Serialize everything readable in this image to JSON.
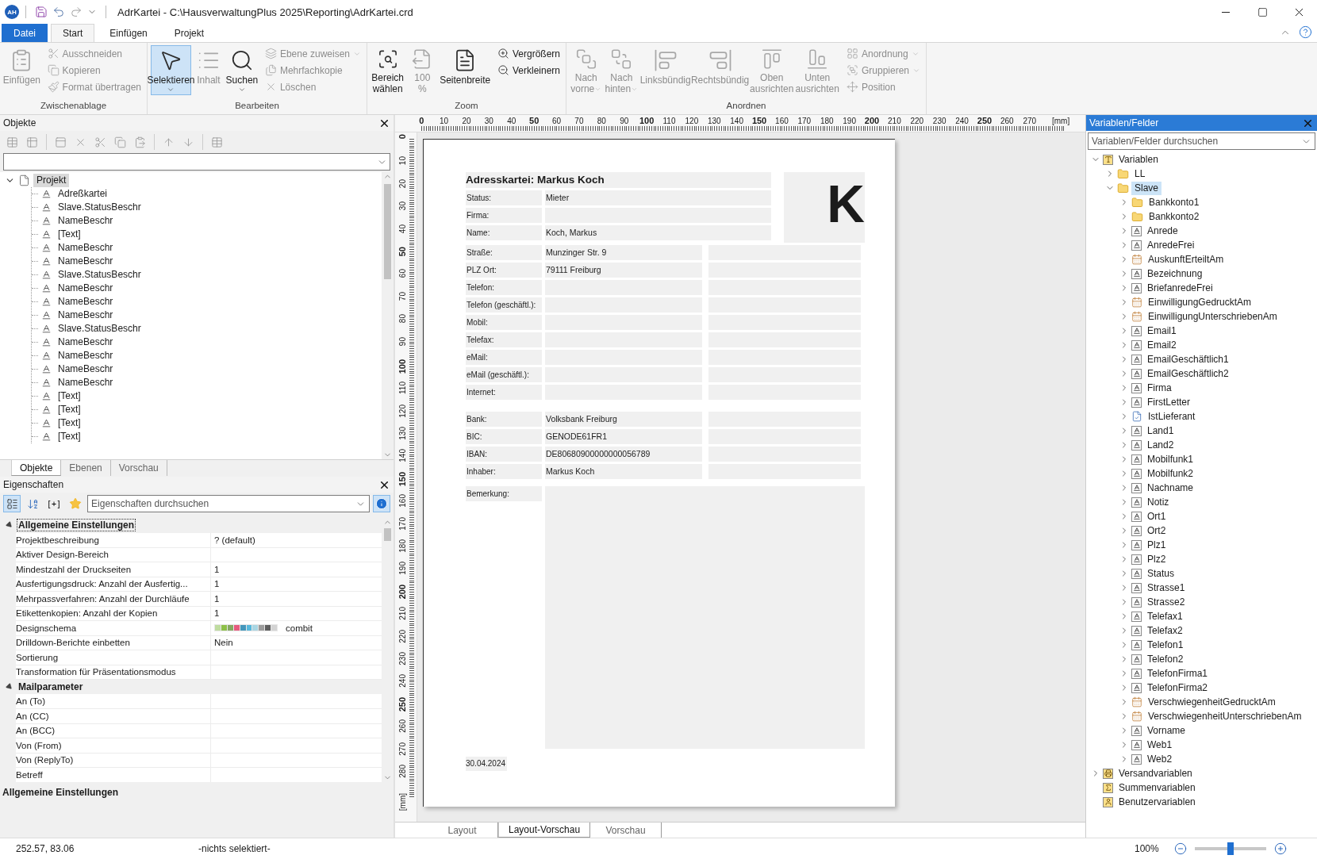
{
  "title_bar": {
    "app_badge": "AH",
    "title": "AdrKartei - C:\\HausverwaltungPlus 2025\\Reporting\\AdrKartei.crd"
  },
  "ribbon": {
    "tabs": [
      {
        "label": "Datei",
        "kind": "file",
        "selected": false
      },
      {
        "label": "Start",
        "kind": "tab",
        "selected": true
      },
      {
        "label": "Einfügen",
        "kind": "tab",
        "selected": false
      },
      {
        "label": "Projekt",
        "kind": "tab",
        "selected": false
      }
    ],
    "groups": [
      {
        "label": "Zwischenablage",
        "items": [
          {
            "kind": "large",
            "lines": [
              "Einfügen"
            ],
            "disabled": true,
            "selected": false,
            "dropdown": false
          },
          {
            "kind": "small",
            "lines": [
              "Ausschneiden"
            ],
            "disabled": true,
            "dropdown": false
          },
          {
            "kind": "small",
            "lines": [
              "Kopieren"
            ],
            "disabled": true,
            "dropdown": false
          },
          {
            "kind": "small",
            "lines": [
              "Format übertragen"
            ],
            "disabled": true,
            "dropdown": false
          }
        ]
      },
      {
        "label": "Bearbeiten",
        "items": [
          {
            "kind": "large",
            "lines": [
              "Selektieren"
            ],
            "disabled": false,
            "selected": true,
            "dropdown": true
          },
          {
            "kind": "large",
            "lines": [
              "Inhalt"
            ],
            "disabled": true,
            "selected": false,
            "dropdown": false
          },
          {
            "kind": "large",
            "lines": [
              "Suchen"
            ],
            "disabled": false,
            "selected": false,
            "dropdown": true
          },
          {
            "kind": "small",
            "lines": [
              "Ebene zuweisen"
            ],
            "disabled": true,
            "dropdown": true
          },
          {
            "kind": "small",
            "lines": [
              "Mehrfachkopie"
            ],
            "disabled": true,
            "dropdown": false
          },
          {
            "kind": "small",
            "lines": [
              "Löschen"
            ],
            "disabled": true,
            "dropdown": false
          }
        ]
      },
      {
        "label": "Zoom",
        "items": [
          {
            "kind": "large",
            "lines": [
              "Bereich",
              "wählen"
            ],
            "disabled": false,
            "selected": false,
            "dropdown": false
          },
          {
            "kind": "large",
            "lines": [
              "100",
              "%"
            ],
            "disabled": true,
            "selected": false,
            "dropdown": false
          },
          {
            "kind": "large",
            "lines": [
              "Seitenbreite"
            ],
            "disabled": false,
            "selected": false,
            "dropdown": false
          },
          {
            "kind": "small",
            "lines": [
              "Vergrößern"
            ],
            "disabled": false,
            "dropdown": false
          },
          {
            "kind": "small",
            "lines": [
              "Verkleinern"
            ],
            "disabled": false,
            "dropdown": false
          }
        ]
      },
      {
        "label": "Anordnen",
        "items": [
          {
            "kind": "large",
            "lines": [
              "Nach",
              "vorne"
            ],
            "disabled": true,
            "selected": false,
            "dropdown": true
          },
          {
            "kind": "large",
            "lines": [
              "Nach",
              "hinten"
            ],
            "disabled": true,
            "selected": false,
            "dropdown": true
          },
          {
            "kind": "large",
            "lines": [
              "Linksbündig"
            ],
            "disabled": true,
            "selected": false,
            "dropdown": false
          },
          {
            "kind": "large",
            "lines": [
              "Rechtsbündig"
            ],
            "disabled": true,
            "selected": false,
            "dropdown": false
          },
          {
            "kind": "large",
            "lines": [
              "Oben",
              "ausrichten"
            ],
            "disabled": true,
            "selected": false,
            "dropdown": false
          },
          {
            "kind": "large",
            "lines": [
              "Unten",
              "ausrichten"
            ],
            "disabled": true,
            "selected": false,
            "dropdown": false
          },
          {
            "kind": "small",
            "lines": [
              "Anordnung"
            ],
            "disabled": true,
            "dropdown": true
          },
          {
            "kind": "small",
            "lines": [
              "Gruppieren"
            ],
            "disabled": true,
            "dropdown": true
          },
          {
            "kind": "small",
            "lines": [
              "Position"
            ],
            "disabled": true,
            "dropdown": false
          }
        ]
      }
    ]
  },
  "objects_panel": {
    "title": "Objekte",
    "tree": {
      "label": "Projekt",
      "selected": true,
      "expanded": true,
      "children": [
        {
          "label": "Adreßkartei",
          "selected": false
        },
        {
          "label": "Slave.StatusBeschr",
          "selected": false
        },
        {
          "label": "NameBeschr",
          "selected": false
        },
        {
          "label": "[Text]",
          "selected": false
        },
        {
          "label": "NameBeschr",
          "selected": false
        },
        {
          "label": "NameBeschr",
          "selected": false
        },
        {
          "label": "Slave.StatusBeschr",
          "selected": false
        },
        {
          "label": "NameBeschr",
          "selected": false
        },
        {
          "label": "NameBeschr",
          "selected": false
        },
        {
          "label": "NameBeschr",
          "selected": false
        },
        {
          "label": "Slave.StatusBeschr",
          "selected": false
        },
        {
          "label": "NameBeschr",
          "selected": false
        },
        {
          "label": "NameBeschr",
          "selected": false
        },
        {
          "label": "NameBeschr",
          "selected": false
        },
        {
          "label": "NameBeschr",
          "selected": false
        },
        {
          "label": "[Text]",
          "selected": false
        },
        {
          "label": "[Text]",
          "selected": false
        },
        {
          "label": "[Text]",
          "selected": false
        },
        {
          "label": "[Text]",
          "selected": false
        }
      ]
    },
    "tabs": [
      {
        "label": "Objekte",
        "selected": true
      },
      {
        "label": "Ebenen",
        "selected": false
      },
      {
        "label": "Vorschau",
        "selected": false
      }
    ]
  },
  "properties_panel": {
    "title": "Eigenschaften",
    "toolbar": [
      {
        "kind": "categorized",
        "selected": true
      },
      {
        "kind": "sort",
        "selected": false
      },
      {
        "kind": "expand",
        "glyph": "[+]",
        "selected": false
      },
      {
        "kind": "favorites",
        "selected": false
      }
    ],
    "search": {
      "placeholder": "Eigenschaften durchsuchen"
    },
    "info_button": {
      "selected": true
    },
    "categories": [
      {
        "label": "Allgemeine Einstellungen",
        "expanded": true,
        "focused": true,
        "rows": [
          {
            "name": "Projektbeschreibung",
            "value": "? (default)"
          },
          {
            "name": "Aktiver Design-Bereich"
          },
          {
            "name": "Mindestzahl der Druckseiten",
            "value": "1"
          },
          {
            "name": "Ausfertigungsdruck: Anzahl der Ausfertig...",
            "value": "1"
          },
          {
            "name": "Mehrpassverfahren: Anzahl der Durchläufe",
            "value": "1"
          },
          {
            "name": "Etikettenkopien: Anzahl der Kopien",
            "value": "1"
          },
          {
            "name": "Designschema",
            "value": "combit",
            "swatches": [
              {
                "color": "#bfdca0"
              },
              {
                "color": "#8dc048"
              },
              {
                "color": "#85a862"
              },
              {
                "color": "#e65b7e"
              },
              {
                "color": "#4496bb"
              },
              {
                "color": "#57b8dc"
              },
              {
                "color": "#a9d6e3"
              },
              {
                "color": "#9c9c9c"
              },
              {
                "color": "#5e5e5e"
              },
              {
                "color": "#d3d3d3"
              }
            ]
          },
          {
            "name": "Drilldown-Berichte einbetten",
            "value": "Nein"
          },
          {
            "name": "Sortierung"
          },
          {
            "name": "Transformation für Präsentationsmodus"
          }
        ]
      },
      {
        "label": "Mailparameter",
        "expanded": true,
        "focused": false,
        "rows": [
          {
            "name": "An (To)"
          },
          {
            "name": "An (CC)"
          },
          {
            "name": "An (BCC)"
          },
          {
            "name": "Von (From)"
          },
          {
            "name": "Von (ReplyTo)"
          },
          {
            "name": "Betreff"
          }
        ]
      }
    ],
    "description": "Allgemeine Einstellungen"
  },
  "canvas": {
    "ruler_top": {
      "labels": [
        "0",
        "10",
        "20",
        "30",
        "40",
        "50",
        "60",
        "70",
        "80",
        "90",
        "100",
        "110",
        "120",
        "130",
        "140",
        "150",
        "160",
        "170",
        "180",
        "190",
        "200",
        "210",
        "220",
        "230",
        "240",
        "250",
        "260",
        "270"
      ],
      "unit": "[mm]"
    },
    "ruler_left": {
      "labels": [
        "0",
        "10",
        "20",
        "30",
        "40",
        "50",
        "60",
        "70",
        "80",
        "90",
        "100",
        "110",
        "120",
        "130",
        "140",
        "150",
        "160",
        "170",
        "180",
        "190",
        "200",
        "210",
        "220",
        "230",
        "240",
        "250",
        "260",
        "270",
        "280"
      ],
      "unit": "[mm]"
    },
    "document": {
      "title": "Adresskartei: Markus Koch",
      "initial": "K",
      "header_rows": [
        {
          "label": "Status:",
          "value": "Mieter"
        },
        {
          "label": "Firma:"
        },
        {
          "label": "Name:",
          "value": "Koch, Markus"
        }
      ],
      "sections": [
        {
          "rows": [
            {
              "label": "Straße:",
              "value": "Munzinger Str. 9"
            },
            {
              "label": "PLZ Ort:",
              "value": "79111 Freiburg"
            },
            {
              "label": "Telefon:"
            },
            {
              "label": "Telefon (geschäftl.):"
            },
            {
              "label": "Mobil:"
            },
            {
              "label": "Telefax:"
            },
            {
              "label": "eMail:"
            },
            {
              "label": "eMail (geschäftl.):"
            },
            {
              "label": "Internet:"
            }
          ]
        },
        {
          "rows": [
            {
              "label": "Bank:",
              "value": "Volksbank Freiburg"
            },
            {
              "label": "BIC:",
              "value": "GENODE61FR1"
            },
            {
              "label": "IBAN:",
              "value": "DE80680900000000056789"
            },
            {
              "label": "Inhaber:",
              "value": "Markus Koch"
            }
          ]
        }
      ],
      "remark_label": "Bemerkung:",
      "date": "30.04.2024"
    },
    "tabs": [
      {
        "label": "Layout",
        "selected": false
      },
      {
        "label": "Layout-Vorschau",
        "selected": true
      },
      {
        "label": "Vorschau",
        "selected": false
      }
    ]
  },
  "variables_panel": {
    "title": "Variablen/Felder",
    "search": {
      "placeholder": "Variablen/Felder durchsuchen"
    },
    "tree": [
      {
        "label": "Variablen",
        "kind": "root",
        "expanded": true,
        "selected": false,
        "children": [
          {
            "label": "LL",
            "kind": "folder",
            "expanded": false,
            "selected": false
          },
          {
            "label": "Slave",
            "kind": "folder",
            "expanded": true,
            "selected": true,
            "children": [
              {
                "label": "Bankkonto1",
                "kind": "folder",
                "expanded": false,
                "selected": false
              },
              {
                "label": "Bankkonto2",
                "kind": "folder",
                "expanded": false,
                "selected": false
              },
              {
                "label": "Anrede",
                "kind": "text",
                "expanded": false,
                "selected": false
              },
              {
                "label": "AnredeFrei",
                "kind": "text",
                "expanded": false,
                "selected": false
              },
              {
                "label": "AuskunftErteiltAm",
                "kind": "date",
                "expanded": false,
                "selected": false
              },
              {
                "label": "Bezeichnung",
                "kind": "text",
                "expanded": false,
                "selected": false
              },
              {
                "label": "BriefanredeFrei",
                "kind": "text",
                "expanded": false,
                "selected": false
              },
              {
                "label": "EinwilligungGedrucktAm",
                "kind": "date",
                "expanded": false,
                "selected": false
              },
              {
                "label": "EinwilligungUnterschriebenAm",
                "kind": "date",
                "expanded": false,
                "selected": false
              },
              {
                "label": "Email1",
                "kind": "text",
                "expanded": false,
                "selected": false
              },
              {
                "label": "Email2",
                "kind": "text",
                "expanded": false,
                "selected": false
              },
              {
                "label": "EmailGeschäftlich1",
                "kind": "text",
                "expanded": false,
                "selected": false
              },
              {
                "label": "EmailGeschäftlich2",
                "kind": "text",
                "expanded": false,
                "selected": false
              },
              {
                "label": "Firma",
                "kind": "text",
                "expanded": false,
                "selected": false
              },
              {
                "label": "FirstLetter",
                "kind": "text",
                "expanded": false,
                "selected": false
              },
              {
                "label": "IstLieferant",
                "kind": "bool",
                "expanded": false,
                "selected": false
              },
              {
                "label": "Land1",
                "kind": "text",
                "expanded": false,
                "selected": false
              },
              {
                "label": "Land2",
                "kind": "text",
                "expanded": false,
                "selected": false
              },
              {
                "label": "Mobilfunk1",
                "kind": "text",
                "expanded": false,
                "selected": false
              },
              {
                "label": "Mobilfunk2",
                "kind": "text",
                "expanded": false,
                "selected": false
              },
              {
                "label": "Nachname",
                "kind": "text",
                "expanded": false,
                "selected": false
              },
              {
                "label": "Notiz",
                "kind": "text",
                "expanded": false,
                "selected": false
              },
              {
                "label": "Ort1",
                "kind": "text",
                "expanded": false,
                "selected": false
              },
              {
                "label": "Ort2",
                "kind": "text",
                "expanded": false,
                "selected": false
              },
              {
                "label": "Plz1",
                "kind": "text",
                "expanded": false,
                "selected": false
              },
              {
                "label": "Plz2",
                "kind": "text",
                "expanded": false,
                "selected": false
              },
              {
                "label": "Status",
                "kind": "text",
                "expanded": false,
                "selected": false
              },
              {
                "label": "Strasse1",
                "kind": "text",
                "expanded": false,
                "selected": false
              },
              {
                "label": "Strasse2",
                "kind": "text",
                "expanded": false,
                "selected": false
              },
              {
                "label": "Telefax1",
                "kind": "text",
                "expanded": false,
                "selected": false
              },
              {
                "label": "Telefax2",
                "kind": "text",
                "expanded": false,
                "selected": false
              },
              {
                "label": "Telefon1",
                "kind": "text",
                "expanded": false,
                "selected": false
              },
              {
                "label": "Telefon2",
                "kind": "text",
                "expanded": false,
                "selected": false
              },
              {
                "label": "TelefonFirma1",
                "kind": "text",
                "expanded": false,
                "selected": false
              },
              {
                "label": "TelefonFirma2",
                "kind": "text",
                "expanded": false,
                "selected": false
              },
              {
                "label": "VerschwiegenheitGedrucktAm",
                "kind": "date",
                "expanded": false,
                "selected": false
              },
              {
                "label": "VerschwiegenheitUnterschriebenAm",
                "kind": "date",
                "expanded": false,
                "selected": false
              },
              {
                "label": "Vorname",
                "kind": "text",
                "expanded": false,
                "selected": false
              },
              {
                "label": "Web1",
                "kind": "text",
                "expanded": false,
                "selected": false
              },
              {
                "label": "Web2",
                "kind": "text",
                "expanded": false,
                "selected": false
              }
            ]
          }
        ]
      },
      {
        "label": "Versandvariablen",
        "kind": "mail",
        "expanded": false,
        "selected": false
      },
      {
        "label": "Summenvariablen",
        "kind": "sum",
        "selected": false
      },
      {
        "label": "Benutzervariablen",
        "kind": "user",
        "selected": false
      }
    ]
  },
  "status_bar": {
    "coordinates": "252.57, 83.06",
    "selection": "-nichts selektiert-",
    "zoom": "100%",
    "zoom_slider": {
      "level": 0.5
    }
  }
}
